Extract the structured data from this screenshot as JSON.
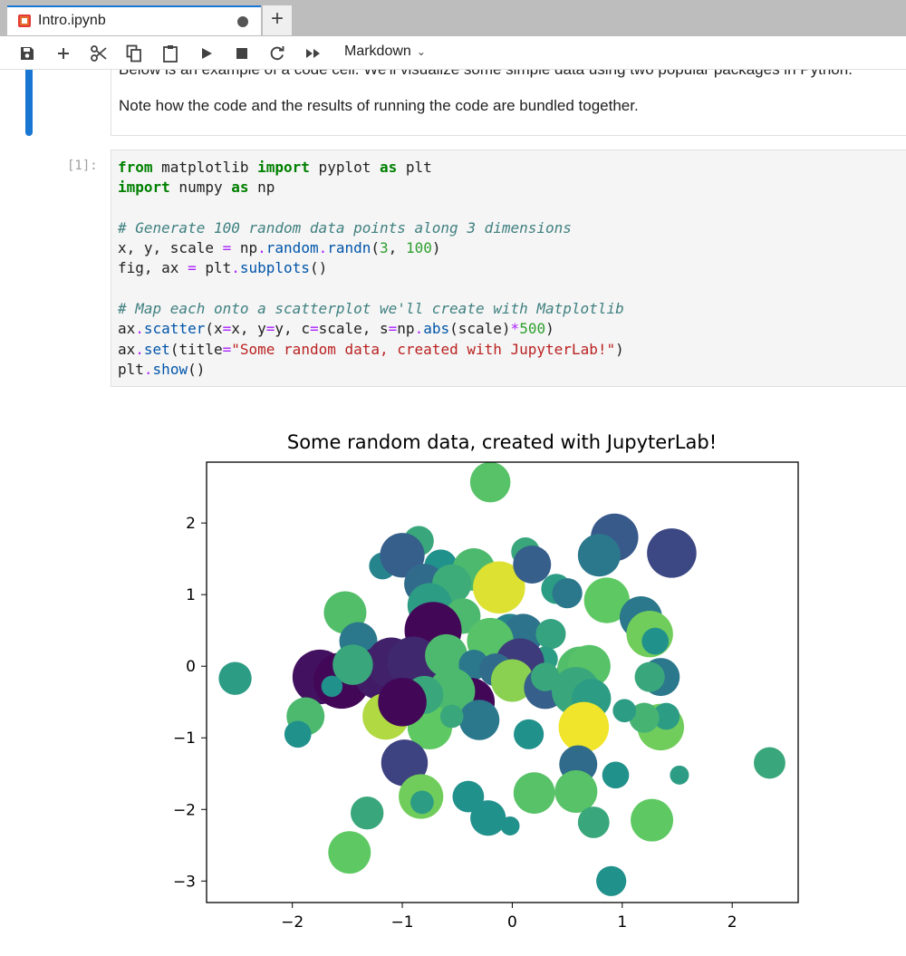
{
  "tab": {
    "title": "Intro.ipynb"
  },
  "toolbar": {
    "cell_type": "Markdown"
  },
  "markdown_cell": {
    "line1": "Below is an example of a code cell. We'll visualize some simple data using two popular packages in Python.",
    "line2": "Note how the code and the results of running the code are bundled together."
  },
  "code_cell": {
    "prompt": "[1]:"
  },
  "chart_data": {
    "type": "scatter",
    "title": "Some random data, created with JupyterLab!",
    "xlim": [
      -2.78,
      2.6
    ],
    "ylim": [
      -3.3,
      2.85
    ],
    "xticks": [
      -2,
      -1,
      0,
      1,
      2
    ],
    "yticks": [
      -3,
      -2,
      -1,
      0,
      1,
      2
    ],
    "colormap": "viridis",
    "points": [
      {
        "x": -0.2,
        "y": 2.57,
        "c": 0.72,
        "s": 0.9
      },
      {
        "x": 0.93,
        "y": 1.8,
        "c": 0.28,
        "s": 1.25
      },
      {
        "x": 1.45,
        "y": 1.58,
        "c": 0.22,
        "s": 1.35
      },
      {
        "x": -0.85,
        "y": 1.75,
        "c": 0.6,
        "s": 0.5
      },
      {
        "x": -1.18,
        "y": 1.4,
        "c": 0.45,
        "s": 0.4
      },
      {
        "x": -1.0,
        "y": 1.55,
        "c": 0.3,
        "s": 1.1
      },
      {
        "x": -0.65,
        "y": 1.4,
        "c": 0.5,
        "s": 0.6
      },
      {
        "x": -0.35,
        "y": 1.35,
        "c": 0.68,
        "s": 1.0
      },
      {
        "x": 0.12,
        "y": 1.6,
        "c": 0.6,
        "s": 0.45
      },
      {
        "x": 0.79,
        "y": 1.55,
        "c": 0.4,
        "s": 1.0
      },
      {
        "x": -0.12,
        "y": 1.1,
        "c": 0.95,
        "s": 1.5
      },
      {
        "x": -0.8,
        "y": 1.15,
        "c": 0.35,
        "s": 0.9
      },
      {
        "x": -0.55,
        "y": 1.15,
        "c": 0.62,
        "s": 0.85
      },
      {
        "x": 0.4,
        "y": 1.08,
        "c": 0.55,
        "s": 0.5
      },
      {
        "x": 0.5,
        "y": 1.02,
        "c": 0.4,
        "s": 0.5
      },
      {
        "x": 0.86,
        "y": 0.92,
        "c": 0.75,
        "s": 1.15
      },
      {
        "x": -1.52,
        "y": 0.75,
        "c": 0.7,
        "s": 1.0
      },
      {
        "x": -0.75,
        "y": 0.85,
        "c": 0.55,
        "s": 1.1
      },
      {
        "x": -0.45,
        "y": 0.7,
        "c": 0.68,
        "s": 0.7
      },
      {
        "x": 1.17,
        "y": 0.68,
        "c": 0.4,
        "s": 1.0
      },
      {
        "x": 1.25,
        "y": 0.45,
        "c": 0.78,
        "s": 1.2
      },
      {
        "x": 1.3,
        "y": 0.35,
        "c": 0.5,
        "s": 0.4
      },
      {
        "x": -1.4,
        "y": 0.35,
        "c": 0.4,
        "s": 0.8
      },
      {
        "x": -0.72,
        "y": 0.5,
        "c": 0.02,
        "s": 1.8
      },
      {
        "x": -0.02,
        "y": 0.45,
        "c": 0.45,
        "s": 0.9
      },
      {
        "x": 0.1,
        "y": 0.45,
        "c": 0.38,
        "s": 0.9
      },
      {
        "x": 0.35,
        "y": 0.45,
        "c": 0.58,
        "s": 0.5
      },
      {
        "x": -0.2,
        "y": 0.35,
        "c": 0.72,
        "s": 1.2
      },
      {
        "x": 0.3,
        "y": 0.1,
        "c": 0.55,
        "s": 0.35
      },
      {
        "x": 0.07,
        "y": 0.05,
        "c": 0.18,
        "s": 1.3
      },
      {
        "x": -1.75,
        "y": -0.15,
        "c": 0.05,
        "s": 1.65
      },
      {
        "x": -1.55,
        "y": -0.2,
        "c": 0.02,
        "s": 1.75
      },
      {
        "x": -1.2,
        "y": -0.1,
        "c": 0.08,
        "s": 1.55
      },
      {
        "x": -1.1,
        "y": 0.05,
        "c": 0.1,
        "s": 1.4
      },
      {
        "x": -0.9,
        "y": 0.05,
        "c": 0.12,
        "s": 1.5
      },
      {
        "x": -1.45,
        "y": 0.02,
        "c": 0.6,
        "s": 0.9
      },
      {
        "x": -0.5,
        "y": -0.05,
        "c": 0.7,
        "s": 0.9
      },
      {
        "x": -0.6,
        "y": 0.15,
        "c": 0.68,
        "s": 1.0
      },
      {
        "x": -0.35,
        "y": 0.02,
        "c": 0.4,
        "s": 0.5
      },
      {
        "x": -0.15,
        "y": -0.05,
        "c": 0.35,
        "s": 0.6
      },
      {
        "x": 0.0,
        "y": -0.2,
        "c": 0.82,
        "s": 1.0
      },
      {
        "x": 0.3,
        "y": -0.3,
        "c": 0.3,
        "s": 1.0
      },
      {
        "x": 0.55,
        "y": -0.25,
        "c": 0.55,
        "s": 1.1
      },
      {
        "x": 0.62,
        "y": -0.05,
        "c": 0.7,
        "s": 1.2
      },
      {
        "x": 0.7,
        "y": 0.0,
        "c": 0.72,
        "s": 1.0
      },
      {
        "x": 0.58,
        "y": -0.35,
        "c": 0.6,
        "s": 1.3
      },
      {
        "x": 0.72,
        "y": -0.45,
        "c": 0.55,
        "s": 0.85
      },
      {
        "x": 1.35,
        "y": -0.15,
        "c": 0.4,
        "s": 0.8
      },
      {
        "x": 1.25,
        "y": -0.15,
        "c": 0.6,
        "s": 0.5
      },
      {
        "x": 0.3,
        "y": -0.15,
        "c": 0.6,
        "s": 0.45
      },
      {
        "x": -0.38,
        "y": -0.5,
        "c": 0.02,
        "s": 1.3
      },
      {
        "x": -0.55,
        "y": -0.35,
        "c": 0.68,
        "s": 1.2
      },
      {
        "x": -0.3,
        "y": -0.75,
        "c": 0.4,
        "s": 0.9
      },
      {
        "x": -0.75,
        "y": -0.85,
        "c": 0.75,
        "s": 1.1
      },
      {
        "x": -0.8,
        "y": -0.4,
        "c": 0.6,
        "s": 0.8
      },
      {
        "x": -1.15,
        "y": -0.7,
        "c": 0.88,
        "s": 1.2
      },
      {
        "x": 0.65,
        "y": -0.85,
        "c": 0.98,
        "s": 1.4
      },
      {
        "x": 1.35,
        "y": -0.85,
        "c": 0.78,
        "s": 1.2
      },
      {
        "x": 1.4,
        "y": -0.7,
        "c": 0.55,
        "s": 0.4
      },
      {
        "x": 1.2,
        "y": -0.72,
        "c": 0.65,
        "s": 0.5
      },
      {
        "x": 1.02,
        "y": -0.62,
        "c": 0.55,
        "s": 0.3
      },
      {
        "x": 0.15,
        "y": -0.95,
        "c": 0.5,
        "s": 0.5
      },
      {
        "x": -1.88,
        "y": -0.7,
        "c": 0.68,
        "s": 0.8
      },
      {
        "x": -1.95,
        "y": -0.95,
        "c": 0.5,
        "s": 0.4
      },
      {
        "x": -1.64,
        "y": -0.28,
        "c": 0.5,
        "s": 0.25
      },
      {
        "x": -2.52,
        "y": -0.17,
        "c": 0.55,
        "s": 0.6
      },
      {
        "x": -0.98,
        "y": -1.35,
        "c": 0.2,
        "s": 1.2
      },
      {
        "x": -0.83,
        "y": -1.82,
        "c": 0.78,
        "s": 1.1
      },
      {
        "x": -0.82,
        "y": -1.9,
        "c": 0.55,
        "s": 0.3
      },
      {
        "x": -0.4,
        "y": -1.82,
        "c": 0.5,
        "s": 0.55
      },
      {
        "x": -0.22,
        "y": -2.12,
        "c": 0.5,
        "s": 0.7
      },
      {
        "x": -0.02,
        "y": -2.23,
        "c": 0.5,
        "s": 0.2
      },
      {
        "x": -1.32,
        "y": -2.05,
        "c": 0.6,
        "s": 0.6
      },
      {
        "x": -1.48,
        "y": -2.6,
        "c": 0.75,
        "s": 1.0
      },
      {
        "x": 0.2,
        "y": -1.77,
        "c": 0.72,
        "s": 0.95
      },
      {
        "x": 0.6,
        "y": -1.37,
        "c": 0.35,
        "s": 0.8
      },
      {
        "x": 0.58,
        "y": -1.75,
        "c": 0.72,
        "s": 1.0
      },
      {
        "x": 0.94,
        "y": -1.52,
        "c": 0.5,
        "s": 0.4
      },
      {
        "x": 0.74,
        "y": -2.18,
        "c": 0.6,
        "s": 0.55
      },
      {
        "x": 1.27,
        "y": -2.15,
        "c": 0.75,
        "s": 1.0
      },
      {
        "x": 1.52,
        "y": -1.52,
        "c": 0.55,
        "s": 0.2
      },
      {
        "x": 2.34,
        "y": -1.35,
        "c": 0.6,
        "s": 0.55
      },
      {
        "x": 0.9,
        "y": -3.0,
        "c": 0.5,
        "s": 0.5
      },
      {
        "x": 0.18,
        "y": 1.42,
        "c": 0.3,
        "s": 0.8
      },
      {
        "x": -1.0,
        "y": -0.5,
        "c": 0.02,
        "s": 1.3
      },
      {
        "x": -0.55,
        "y": -0.7,
        "c": 0.6,
        "s": 0.3
      }
    ]
  }
}
